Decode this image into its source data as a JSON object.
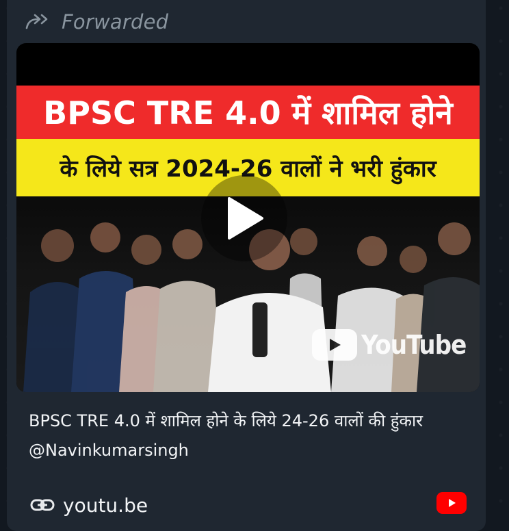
{
  "message": {
    "forward_label": "Forwarded",
    "preview": {
      "thumbnail": {
        "banner_line1": "BPSC TRE 4.0 में शामिल होने",
        "banner_line2": "के लिये सत्र 2024-26 वालों ने भरी हुंकार",
        "watermark": "YouTube"
      },
      "title": "BPSC TRE 4.0 में शामिल होने के लिये 24-26 वालों की हुंकार @Navinkumarsingh",
      "domain": "youtu.be"
    }
  },
  "colors": {
    "bubble": "#1f2731",
    "banner_red": "#ef2b2b",
    "banner_yellow": "#f5e71a",
    "youtube_red": "#ff0000",
    "muted_text": "#8a959f"
  },
  "icons": {
    "forward": "forward-arrow-icon",
    "play": "play-icon",
    "link": "link-icon",
    "site": "youtube-icon"
  }
}
